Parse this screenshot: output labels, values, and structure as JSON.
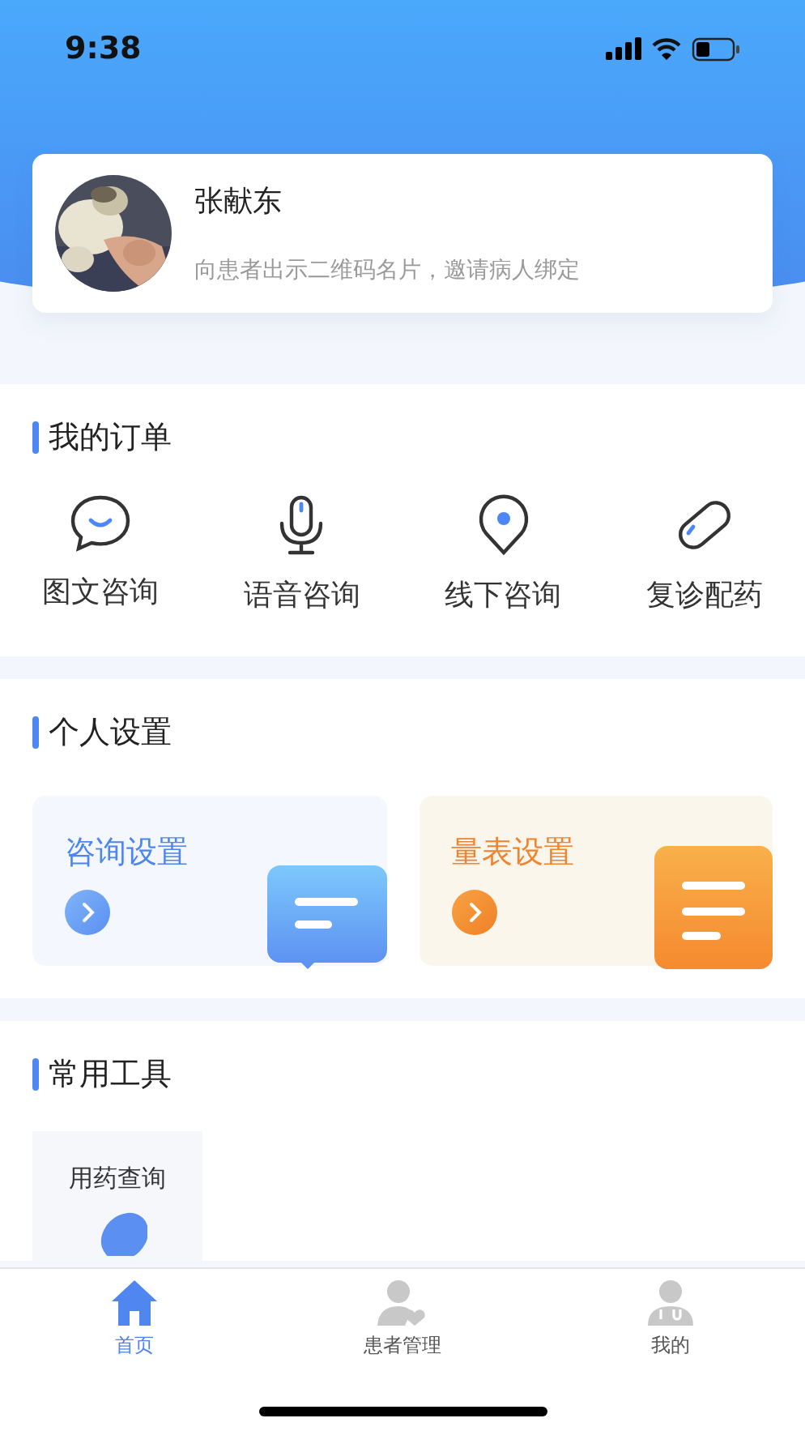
{
  "status_bar": {
    "time": "9:38"
  },
  "profile": {
    "name": "张献东",
    "subtitle": "向患者出示二维码名片，邀请病人绑定"
  },
  "orders": {
    "title": "我的订单",
    "items": [
      {
        "label": "图文咨询",
        "kind": "chat"
      },
      {
        "label": "语音咨询",
        "kind": "mic"
      },
      {
        "label": "线下咨询",
        "kind": "pin"
      },
      {
        "label": "复诊配药",
        "kind": "pill"
      }
    ]
  },
  "settings": {
    "title": "个人设置",
    "cards": [
      {
        "title": "咨询设置",
        "kind": "consult"
      },
      {
        "title": "量表设置",
        "kind": "scale"
      }
    ]
  },
  "tools": {
    "title": "常用工具",
    "items": [
      {
        "label": "用药查询"
      }
    ]
  },
  "tab_bar": [
    {
      "label": "首页",
      "kind": "home",
      "selected": true
    },
    {
      "label": "患者管理",
      "kind": "patients",
      "selected": false
    },
    {
      "label": "我的",
      "kind": "doctor",
      "selected": false
    }
  ]
}
